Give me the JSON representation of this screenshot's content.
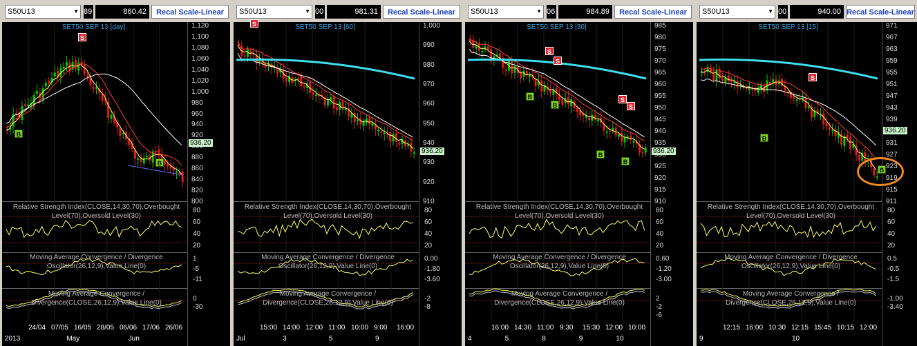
{
  "panels": [
    {
      "symbol": "S50U13",
      "field_left": "89",
      "price": "860.42",
      "scale_button": "Recal Scale-Linear",
      "title": "SET50 SEP 13   [day]",
      "price_axis": [
        "1,120",
        "1,100",
        "1,080",
        "1,060",
        "1,040",
        "1,020",
        "1,000",
        "980",
        "960",
        "940",
        "920",
        "900",
        "880",
        "860",
        "840",
        "820",
        "800"
      ],
      "price_tag": "936.20",
      "rsi_label": "Relative Strength Index(CLOSE,14,30,70),Overbought Level(70),Oversold Level(30)",
      "rsi_axis": [
        "80",
        "60",
        "40",
        "20"
      ],
      "macd_osc_label": "Moving Average Convergence / Divergence Oscillator(26,12,9),Value Line(0)",
      "macd_osc_axis": [
        "1",
        "-5",
        "-11"
      ],
      "macd_label": "Moving Average Convergence / Divergence(CLOSE,26,12,9),Value Line(0)",
      "macd_axis": [
        "0",
        "-30"
      ],
      "x_dates": [
        "24/04",
        "07/05",
        "16/05",
        "28/05",
        "06/06",
        "17/06",
        "26/06"
      ],
      "x_months": [
        "2013",
        "May",
        "Jun"
      ],
      "signals": [
        "S",
        "B",
        "B"
      ]
    },
    {
      "symbol": "S50U13",
      "field_left": "00",
      "price": "981.31",
      "scale_button": "Recal Scale-Linear",
      "title": "SET50 SEP 13   [60]",
      "price_axis": [
        "1,000",
        "990",
        "980",
        "970",
        "960",
        "950",
        "940",
        "930",
        "920",
        "910"
      ],
      "price_tag": "936.20",
      "rsi_label": "Relative Strength Index(CLOSE,14,30,70),Overbought Level(70),Oversold Level(30)",
      "rsi_axis": [
        "80",
        "60",
        "40",
        "20"
      ],
      "macd_osc_label": "Moving Average Convergence / Divergence Oscillator(26,12,9),Value Line(0)",
      "macd_osc_axis": [
        "0.00",
        "-1.80",
        "-3.60"
      ],
      "macd_label": "Moving Average Convergence / Divergence(CLOSE,26,12,9),Value Line(0)",
      "macd_axis": [
        "-2",
        "-8"
      ],
      "x_dates": [
        "15:00",
        "14:00",
        "12:00",
        "11:00",
        "10:00",
        "9:00",
        "16:00"
      ],
      "x_months": [
        "Jul",
        "3",
        "5",
        "9"
      ],
      "signals": [
        "S"
      ]
    },
    {
      "symbol": "S50U13",
      "field_left": "06",
      "price": "984.89",
      "scale_button": "Recal Scale-Linear",
      "title": "SET50 SEP 13   [30]",
      "price_axis": [
        "985",
        "980",
        "975",
        "970",
        "965",
        "960",
        "955",
        "950",
        "945",
        "940",
        "935",
        "930",
        "925",
        "920",
        "915",
        "910"
      ],
      "price_tag": "936.20",
      "rsi_label": "Relative Strength Index(CLOSE,14,30,70),Overbought Level(70),Oversold Level(30)",
      "rsi_axis": [
        "80",
        "60",
        "40",
        "20"
      ],
      "macd_osc_label": "Moving Average Convergence / Divergence Oscillator(26,12,9),Value Line(0)",
      "macd_osc_axis": [
        "0.60",
        "-1.20",
        "-3.00"
      ],
      "macd_label": "Moving Average Convergence / Divergence(CLOSE,26,12,9),Value Line(0)",
      "macd_axis": [
        "2",
        "-2",
        "-6"
      ],
      "x_dates": [
        "16:00",
        "14:30",
        "11:00",
        "9:30",
        "15:30",
        "12:00",
        "10:00"
      ],
      "x_months": [
        "4",
        "5",
        "8",
        "9",
        "10"
      ],
      "signals": [
        "S",
        "S",
        "S",
        "S",
        "B",
        "B",
        "B",
        "B"
      ]
    },
    {
      "symbol": "S50U13",
      "field_left": "00",
      "price": "940.00",
      "scale_button": "Recal Scale-Linear",
      "title": "SET50 SEP 13   [15]",
      "price_axis": [
        "971",
        "967",
        "963",
        "959",
        "955",
        "951",
        "947",
        "943",
        "939",
        "935",
        "931",
        "927",
        "923",
        "919",
        "915",
        "911"
      ],
      "price_tag": "936.20",
      "rsi_label": "Relative Strength Index(CLOSE,14,30,70),Overbought Level(70),Oversold Level(30)",
      "rsi_axis": [
        "80",
        "60",
        "40",
        "20"
      ],
      "macd_osc_label": "Moving Average Convergence / Divergence Oscillator(26,12,9),Value Line(0)",
      "macd_osc_axis": [
        "0.5",
        "-0.5",
        "-1.5"
      ],
      "macd_label": "Moving Average Convergence / Divergence(CLOSE,26,12,9),Value Line(0)",
      "macd_axis": [
        "-1.00",
        "-3.40"
      ],
      "x_dates": [
        "12:15",
        "16:00",
        "10:30",
        "12:15",
        "15:45",
        "10:15",
        "12:00"
      ],
      "x_months": [
        "9",
        "10"
      ],
      "signals": [
        "S",
        "B",
        "B"
      ]
    }
  ],
  "colors": {
    "up": "#00c800",
    "down": "#e11b1b",
    "ma_fast": "#ffff66",
    "ma_mid": "#ff3b3b",
    "ma_slow": "#ffffff",
    "ma_long": "#3ee0f0",
    "highlight": "#f08a24"
  }
}
